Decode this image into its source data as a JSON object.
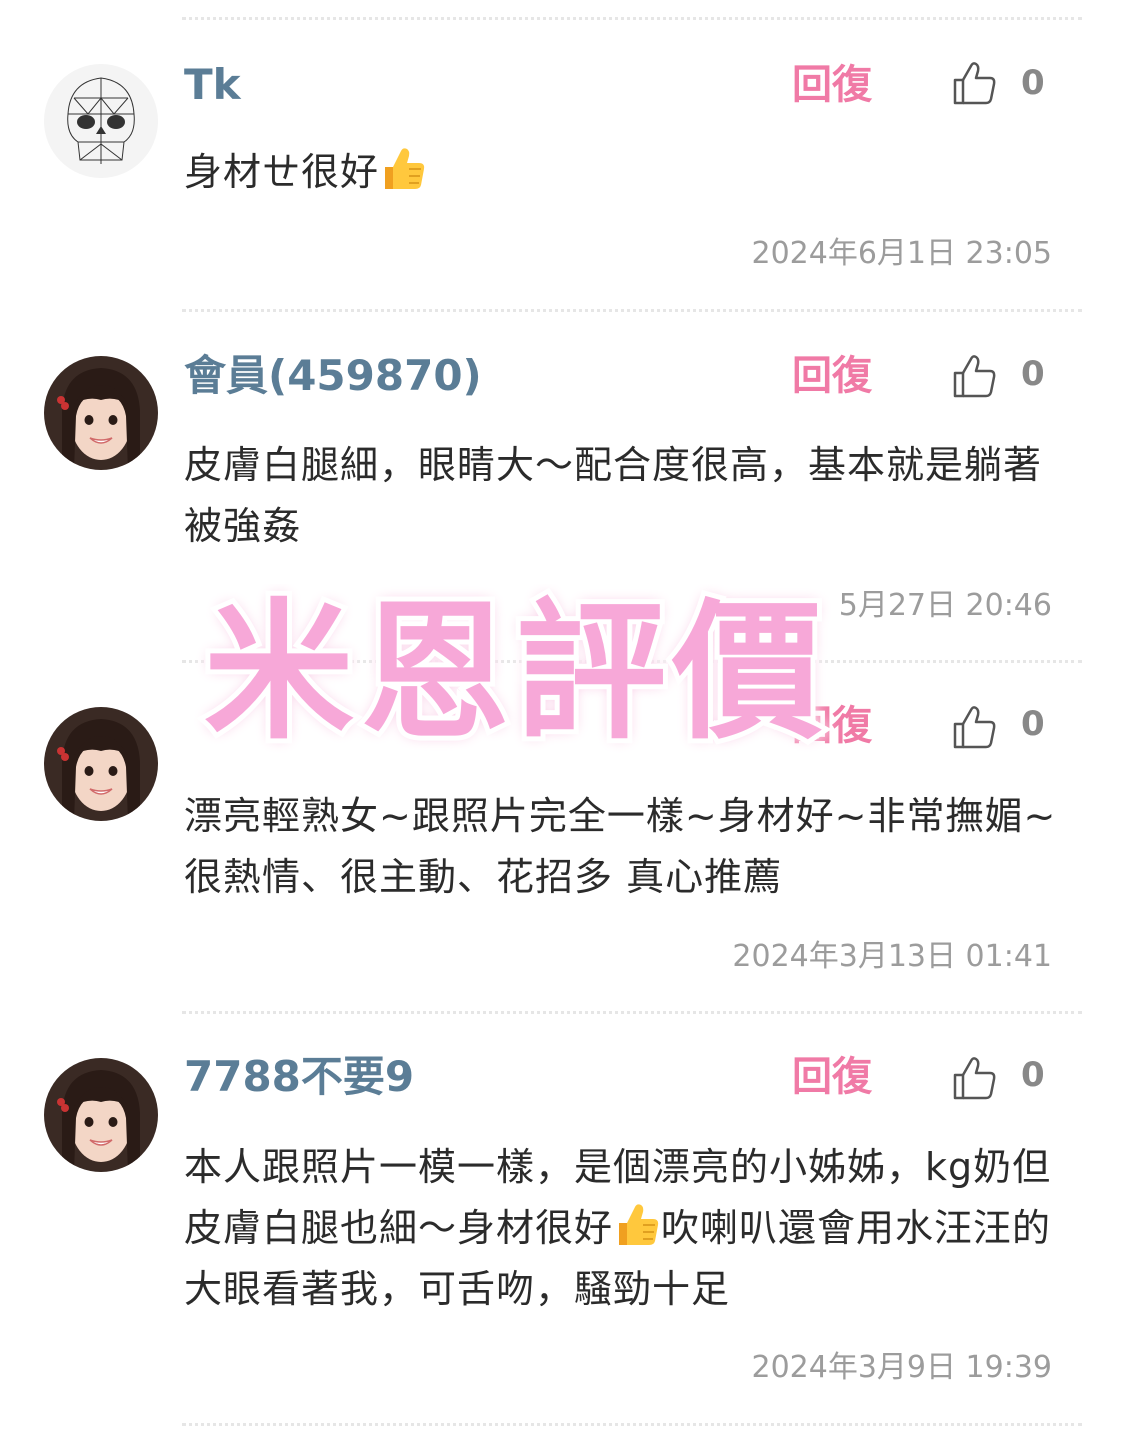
{
  "reply_label": "回復",
  "comments": [
    {
      "username": "Tk",
      "avatar": "skull-sketch-avatar",
      "likes": "0",
      "text_before": "身材ㄝ很好",
      "text_after": "",
      "has_thumb": true,
      "date": "2024年6月1日 23:05"
    },
    {
      "username": "會員(459870)",
      "avatar": "girl-photo-avatar",
      "likes": "0",
      "text_before": "皮膚白腿細，眼睛大～配合度很高，基本就是躺著被強姦",
      "text_after": "",
      "has_thumb": false,
      "date": "5月27日 20:46"
    },
    {
      "username": "",
      "avatar": "girl-photo-avatar",
      "likes": "0",
      "text_before": "漂亮輕熟女~跟照片完全一樣~身材好~非常撫媚~很熱情、很主動、花招多 真心推薦",
      "text_after": "",
      "has_thumb": false,
      "date": "2024年3月13日 01:41"
    },
    {
      "username": "7788不要9",
      "avatar": "girl-photo-avatar",
      "likes": "0",
      "text_before": "本人跟照片一模一樣，是個漂亮的小姊姊，kg奶但皮膚白腿也細～身材很好",
      "text_after": "吹喇叭還會用水汪汪的大眼看著我，可舌吻，騷勁十足",
      "has_thumb": true,
      "date": "2024年3月9日 19:39"
    }
  ],
  "watermark": "米恩評價",
  "colors": {
    "username": "#5b7d96",
    "reply": "#f07aa6",
    "watermark": "#f7a8d8"
  }
}
